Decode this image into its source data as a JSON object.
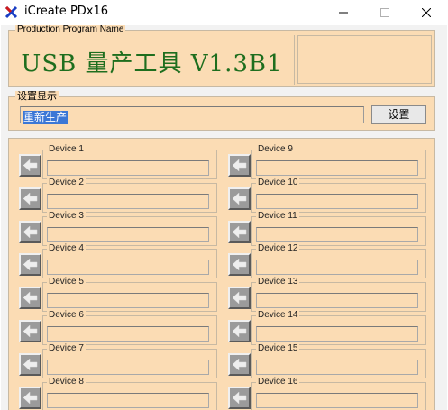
{
  "window": {
    "title": "iCreate PDx16"
  },
  "program": {
    "group_label": "Production Program Name",
    "name": "USB 量产工具 V1.3B1"
  },
  "settings": {
    "group_label": "设置显示",
    "value": "重新生产",
    "button": "设置"
  },
  "devices": [
    {
      "label": "Device 1"
    },
    {
      "label": "Device 2"
    },
    {
      "label": "Device 3"
    },
    {
      "label": "Device 4"
    },
    {
      "label": "Device 5"
    },
    {
      "label": "Device 6"
    },
    {
      "label": "Device 7"
    },
    {
      "label": "Device 8"
    },
    {
      "label": "Device 9"
    },
    {
      "label": "Device 10"
    },
    {
      "label": "Device 11"
    },
    {
      "label": "Device 12"
    },
    {
      "label": "Device 13"
    },
    {
      "label": "Device 14"
    },
    {
      "label": "Device 15"
    },
    {
      "label": "Device 16"
    }
  ],
  "icons": {
    "app": "usb-tool-icon",
    "arrow": "arrow-left-icon"
  },
  "colors": {
    "panel": "#fbdcb4",
    "program_text": "#1e6e1e",
    "selection": "#3b77d6"
  }
}
